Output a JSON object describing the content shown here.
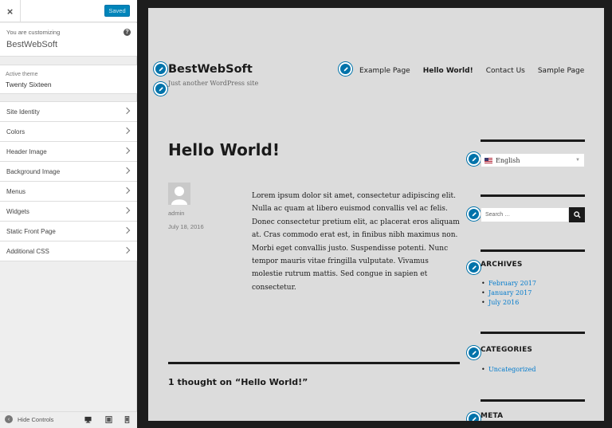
{
  "sidebar": {
    "close_symbol": "×",
    "saved_label": "Saved",
    "customizing_label": "You are customizing",
    "site_name": "BestWebSoft",
    "help_symbol": "?",
    "active_theme_label": "Active theme",
    "theme_name": "Twenty Sixteen",
    "sections": [
      {
        "label": "Site Identity"
      },
      {
        "label": "Colors"
      },
      {
        "label": "Header Image"
      },
      {
        "label": "Background Image"
      },
      {
        "label": "Menus"
      },
      {
        "label": "Widgets"
      },
      {
        "label": "Static Front Page"
      },
      {
        "label": "Additional CSS"
      }
    ],
    "footer": {
      "hide_controls_label": "Hide Controls",
      "devices": [
        "desktop-icon",
        "tablet-icon",
        "mobile-icon"
      ]
    }
  },
  "preview": {
    "site_title": "BestWebSoft",
    "tagline": "Just another WordPress site",
    "nav": [
      {
        "label": "Example Page",
        "current": false
      },
      {
        "label": "Hello World!",
        "current": true
      },
      {
        "label": "Contact Us",
        "current": false
      },
      {
        "label": "Sample Page",
        "current": false
      }
    ],
    "post": {
      "title": "Hello World!",
      "author": "admin",
      "date": "July 18, 2016",
      "body": "Lorem ipsum dolor sit amet, consectetur adipiscing elit. Nulla ac quam at libero euismod convallis vel ac felis. Donec consectetur pretium elit, ac placerat eros aliquam at. Cras commodo erat est, in finibus nibh maximus non. Morbi eget convallis justo. Suspendisse potenti. Nunc tempor mauris vitae fringilla vulputate. Vivamus molestie rutrum mattis. Sed congue in sapien et consectetur."
    },
    "comments_title": "1 thought on “Hello World!”",
    "widgets": {
      "language": "English",
      "search_placeholder": "Search …",
      "archives_title": "ARCHIVES",
      "archives": [
        "February 2017",
        "January 2017",
        "July 2016"
      ],
      "categories_title": "CATEGORIES",
      "categories": [
        "Uncategorized"
      ],
      "meta_title": "META"
    }
  },
  "colors": {
    "accent": "#0073aa",
    "saved_button": "#0085ba",
    "link": "#007acc",
    "frame_background": "#dcdcdc",
    "outer_background": "#1d1d1d"
  }
}
